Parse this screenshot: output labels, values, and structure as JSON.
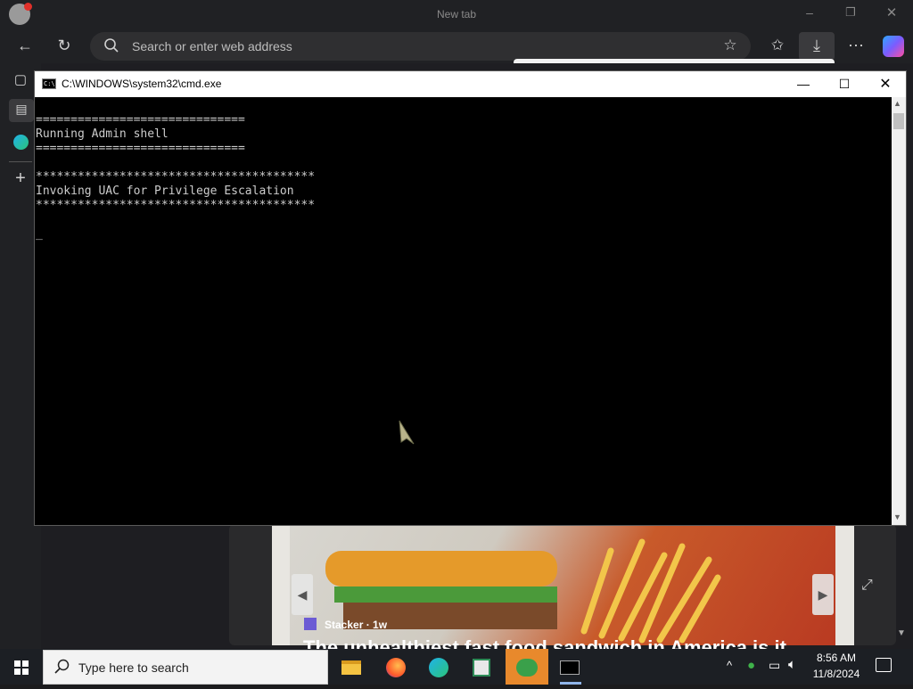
{
  "browser": {
    "tab_title": "New tab",
    "address_placeholder": "Search or enter web address"
  },
  "cmd": {
    "title": "C:\\WINDOWS\\system32\\cmd.exe",
    "lines": [
      "==============================",
      "Running Admin shell",
      "==============================",
      "",
      "****************************************",
      "Invoking UAC for Privilege Escalation",
      "****************************************",
      "",
      "_"
    ]
  },
  "news": {
    "source": "Stacker · 1w",
    "headline": "The unhealthiest fast food sandwich in America is it"
  },
  "taskbar": {
    "search_placeholder": "Type here to search",
    "time": "8:56 AM",
    "date": "11/8/2024"
  },
  "colors": {
    "console_bg": "#000000",
    "console_text": "#cccccc",
    "taskbar_active": "#e8892c"
  }
}
